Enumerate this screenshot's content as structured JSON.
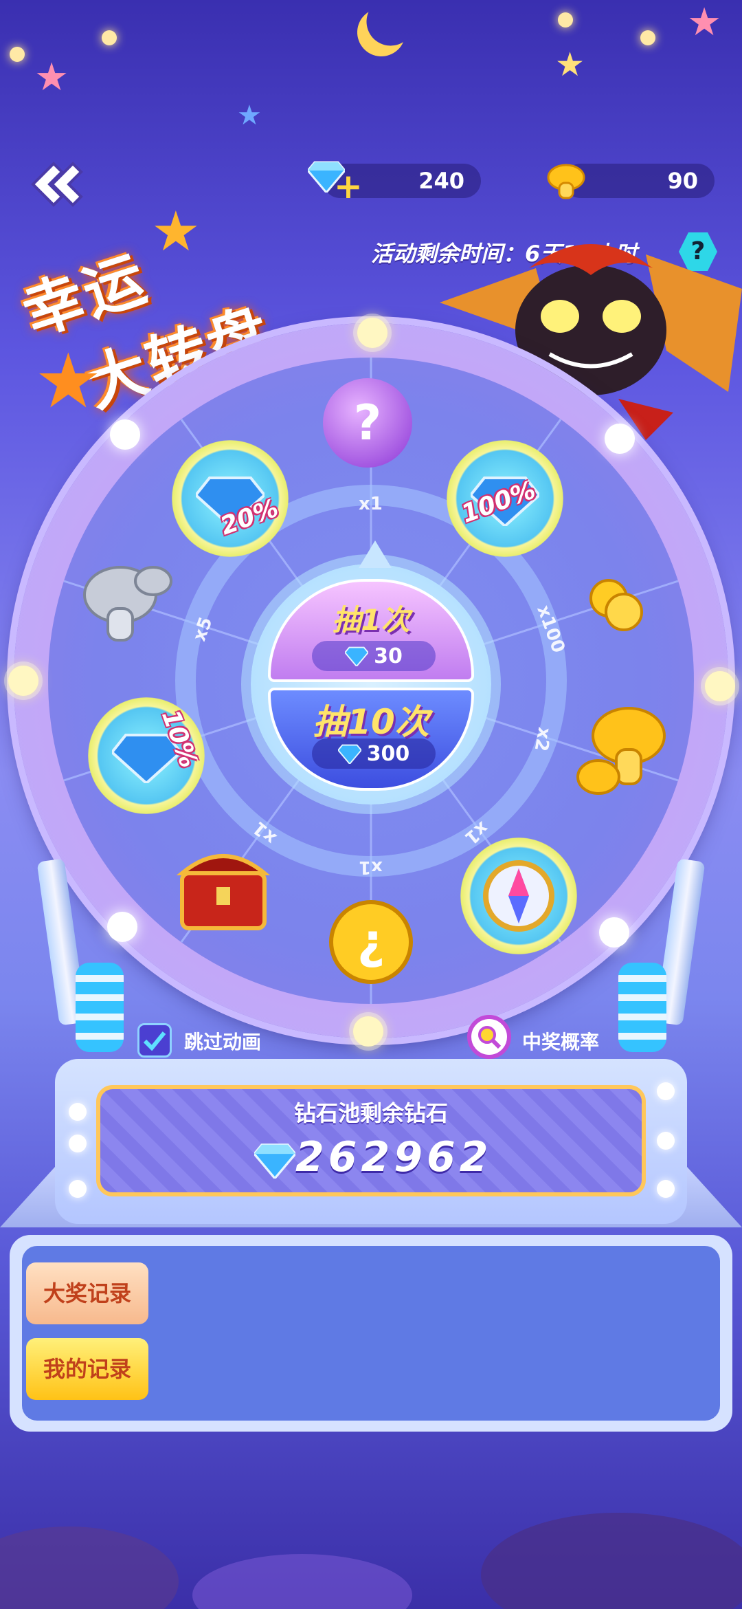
{
  "resources": {
    "diamond": {
      "value": "240",
      "icon": "diamond-icon",
      "color": "#3ab4ff"
    },
    "mushroom": {
      "value": "90",
      "icon": "mushroom-icon",
      "color": "#ffc21a"
    }
  },
  "event": {
    "title_line1": "幸运",
    "title_line2": "大转盘",
    "time_remaining": "活动剩余时间：6天11小时",
    "help_label": "?"
  },
  "wheel": {
    "prizes": [
      {
        "name": "mystery-orb",
        "label": "?"
      },
      {
        "name": "diamond-pile-100",
        "label": "100%"
      },
      {
        "name": "gold-coins",
        "label": ""
      },
      {
        "name": "gold-mushrooms",
        "label": ""
      },
      {
        "name": "compass-badge",
        "label": ""
      },
      {
        "name": "gold-mystery-coin",
        "label": ""
      },
      {
        "name": "treasure-chest",
        "label": ""
      },
      {
        "name": "diamond-pile-10",
        "label": "10%"
      },
      {
        "name": "silver-mushrooms",
        "label": ""
      },
      {
        "name": "diamond-pile-20",
        "label": "20%"
      }
    ],
    "multipliers": [
      "x1",
      "x100",
      "x2",
      "x1",
      "x1",
      "x1",
      "x5"
    ]
  },
  "draw": {
    "single_label": "抽1次",
    "single_cost": "30",
    "ten_label": "抽10次",
    "ten_cost": "300"
  },
  "options": {
    "skip_animation_label": "跳过动画",
    "skip_animation_checked": true,
    "win_probability_label": "中奖概率"
  },
  "pool": {
    "title": "钻石池剩余钻石",
    "value": "262962"
  },
  "records": {
    "grand_prize_label": "大奖记录",
    "my_records_label": "我的记录"
  }
}
